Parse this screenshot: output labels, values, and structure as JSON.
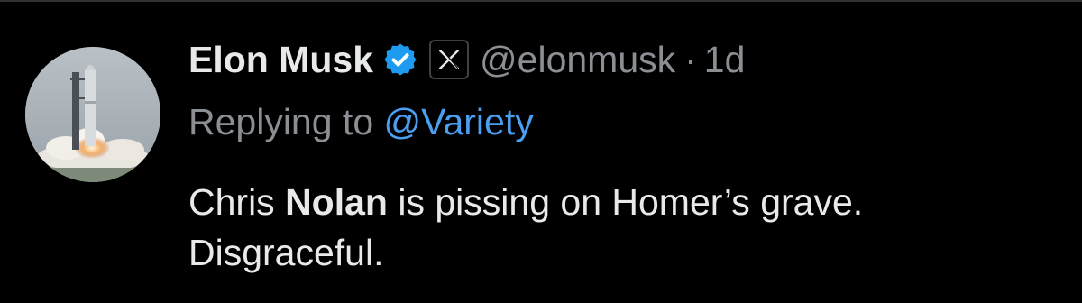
{
  "author": {
    "display_name": "Elon Musk",
    "handle": "@elonmusk",
    "separator": "·",
    "time_ago": "1d",
    "verified_icon": "verified-badge-icon",
    "affiliate_icon": "x-logo-icon"
  },
  "reply": {
    "prefix": "Replying to",
    "target": "@Variety"
  },
  "tweet": {
    "part1": "Chris ",
    "bold": "Nolan",
    "part2": " is pissing on Homer’s grave. Disgraceful."
  },
  "colors": {
    "background": "#000000",
    "primary_text": "#e7e9ea",
    "secondary_text": "#8b8f93",
    "link": "#4a9ff0",
    "verified": "#1d9bf0"
  }
}
